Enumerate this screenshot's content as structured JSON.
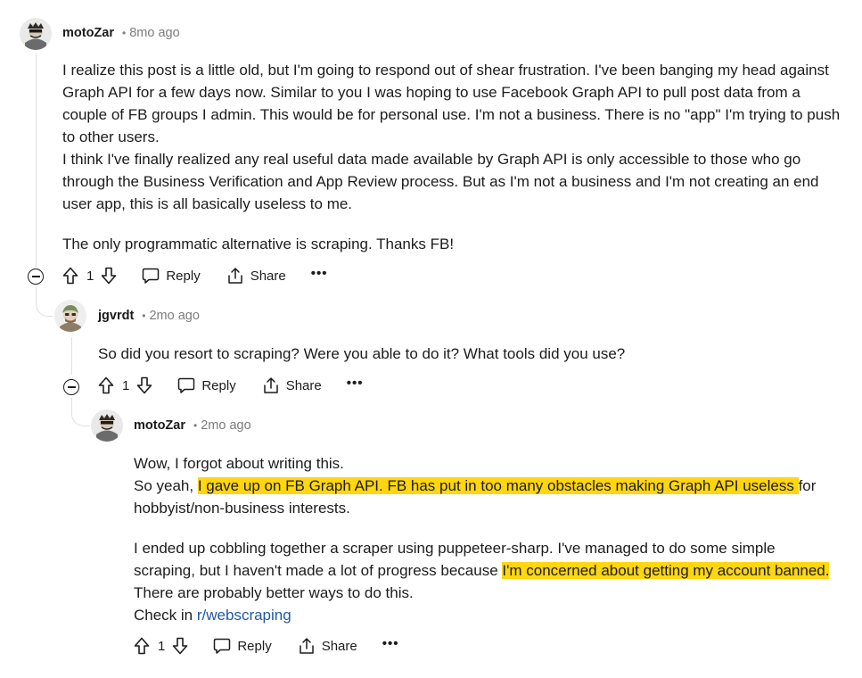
{
  "comments": [
    {
      "username": "motoZar",
      "dot": "•",
      "timestamp": "8mo ago",
      "body": {
        "p1": "I realize this post is a little old, but I'm going to respond out of shear frustration. I've been banging my head against Graph API for a few days now. Similar to you I was hoping to use Facebook Graph API to pull post data from a couple of FB groups I admin. This would be for personal use. I'm not a business. There is no \"app\" I'm trying to push to other users.",
        "p2": "I think I've finally realized any real useful data made available by Graph API is only accessible to those who go through the Business Verification and App Review process. But as I'm not a business and I'm not creating an end user app, this is all basically useless to me.",
        "p3": "The only programmatic alternative is scraping. Thanks FB!"
      },
      "actions": {
        "vote_count": "1",
        "reply_label": "Reply",
        "share_label": "Share",
        "more_label": "•••"
      }
    },
    {
      "username": "jgvrdt",
      "dot": "•",
      "timestamp": "2mo ago",
      "body": {
        "p1": "So did you resort to scraping? Were you able to do it? What tools did you use?"
      },
      "actions": {
        "vote_count": "1",
        "reply_label": "Reply",
        "share_label": "Share",
        "more_label": "•••"
      }
    },
    {
      "username": "motoZar",
      "dot": "•",
      "timestamp": "2mo ago",
      "body": {
        "line1": "Wow, I forgot about writing this.",
        "line2_pre": "So yeah, ",
        "line2_hl": "I gave up on FB Graph API. FB has put in too many obstacles making Graph API useless ",
        "line2_post": "for hobbyist/non-business interests.",
        "p2_pre": "I ended up cobbling together a scraper using puppeteer-sharp. I've managed to do some simple scraping, but I haven't made a lot of progress because ",
        "p2_hl": "I'm concerned about getting my account banned.",
        "p2_post": " There are probably better ways to do this.",
        "p3_pre": "Check in ",
        "p3_link": "r/webscraping"
      },
      "actions": {
        "vote_count": "1",
        "reply_label": "Reply",
        "share_label": "Share",
        "more_label": "•••"
      }
    }
  ],
  "colors": {
    "highlight": "#ffd60f",
    "link": "#1f5aa6",
    "meta": "#7c7c7c",
    "thread_line": "#dbe0e5"
  },
  "icons": {
    "upvote": "arrow-up-icon",
    "downvote": "arrow-down-icon",
    "reply": "speech-bubble-icon",
    "share": "share-icon",
    "collapse": "minus-circle-icon"
  }
}
